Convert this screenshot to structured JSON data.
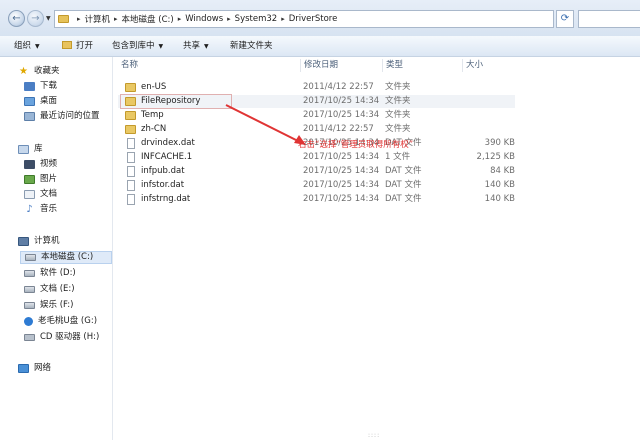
{
  "address": {
    "crumbs": [
      "计算机",
      "本地磁盘 (C:)",
      "Windows",
      "System32",
      "DriverStore"
    ]
  },
  "toolbar": {
    "organize": "组织",
    "open": "打开",
    "include_in_library": "包含到库中",
    "share": "共享",
    "new_folder": "新建文件夹"
  },
  "nav": {
    "favorites": "收藏夹",
    "downloads": "下载",
    "desktop": "桌面",
    "recent": "最近访问的位置",
    "libraries": "库",
    "videos": "视频",
    "pictures": "图片",
    "documents": "文档",
    "music": "音乐",
    "computer": "计算机",
    "drive_c": "本地磁盘 (C:)",
    "drive_d": "软件 (D:)",
    "drive_e": "文档 (E:)",
    "drive_f": "娱乐 (F:)",
    "drive_g": "老毛桃U盘 (G:)",
    "drive_h": "CD 驱动器 (H:)",
    "network": "网络"
  },
  "columns": {
    "name": "名称",
    "modified": "修改日期",
    "type": "类型",
    "size": "大小"
  },
  "files": [
    {
      "name": "en-US",
      "date": "2011/4/12 22:57",
      "type": "文件夹",
      "size": "",
      "kind": "folder"
    },
    {
      "name": "FileRepository",
      "date": "2017/10/25 14:34",
      "type": "文件夹",
      "size": "",
      "kind": "folder"
    },
    {
      "name": "Temp",
      "date": "2017/10/25 14:34",
      "type": "文件夹",
      "size": "",
      "kind": "folder"
    },
    {
      "name": "zh-CN",
      "date": "2011/4/12 22:57",
      "type": "文件夹",
      "size": "",
      "kind": "folder"
    },
    {
      "name": "drvindex.dat",
      "date": "2017/10/25 14:34",
      "type": "DAT 文件",
      "size": "390 KB",
      "kind": "file"
    },
    {
      "name": "INFCACHE.1",
      "date": "2017/10/25 14:34",
      "type": "1 文件",
      "size": "2,125 KB",
      "kind": "file"
    },
    {
      "name": "infpub.dat",
      "date": "2017/10/25 14:34",
      "type": "DAT 文件",
      "size": "84 KB",
      "kind": "file"
    },
    {
      "name": "infstor.dat",
      "date": "2017/10/25 14:34",
      "type": "DAT 文件",
      "size": "140 KB",
      "kind": "file"
    },
    {
      "name": "infstrng.dat",
      "date": "2017/10/25 14:34",
      "type": "DAT 文件",
      "size": "140 KB",
      "kind": "file"
    }
  ],
  "annotation": {
    "text": "右击“选择”管理员取得所有权”",
    "color": "#e03434"
  }
}
